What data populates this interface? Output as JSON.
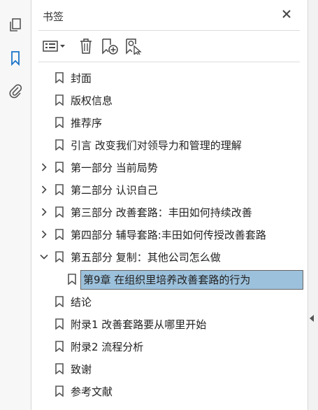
{
  "panel": {
    "title": "书签"
  },
  "sidebar": {
    "icons": [
      "pages-icon",
      "bookmark-icon",
      "attachment-icon"
    ]
  },
  "toolbar": {
    "buttons": [
      "options-menu-button",
      "delete-bookmark-button",
      "new-bookmark-button",
      "find-bookmark-button"
    ]
  },
  "bookmarks": [
    {
      "label": "封面",
      "level": 0,
      "expandable": false
    },
    {
      "label": "版权信息",
      "level": 0,
      "expandable": false
    },
    {
      "label": "推荐序",
      "level": 0,
      "expandable": false
    },
    {
      "label": "引言 改变我们对领导力和管理的理解",
      "level": 0,
      "expandable": false
    },
    {
      "label": "第一部分 当前局势",
      "level": 0,
      "expandable": true,
      "expanded": false
    },
    {
      "label": "第二部分 认识自己",
      "level": 0,
      "expandable": true,
      "expanded": false
    },
    {
      "label": "第三部分 改善套路：丰田如何持续改善",
      "level": 0,
      "expandable": true,
      "expanded": false
    },
    {
      "label": "第四部分 辅导套路:丰田如何传授改善套路",
      "level": 0,
      "expandable": true,
      "expanded": false
    },
    {
      "label": "第五部分 复制：其他公司怎么做",
      "level": 0,
      "expandable": true,
      "expanded": true
    },
    {
      "label": "第9章 在组织里培养改善套路的行为",
      "level": 1,
      "expandable": false,
      "selected": true
    },
    {
      "label": "结论",
      "level": 0,
      "expandable": false
    },
    {
      "label": "附录1 改善套路要从哪里开始",
      "level": 0,
      "expandable": false
    },
    {
      "label": "附录2 流程分析",
      "level": 0,
      "expandable": false
    },
    {
      "label": "致谢",
      "level": 0,
      "expandable": false
    },
    {
      "label": "参考文献",
      "level": 0,
      "expandable": false
    }
  ],
  "colors": {
    "selection": "#9cc1dc",
    "active_icon": "#1a73c8"
  }
}
